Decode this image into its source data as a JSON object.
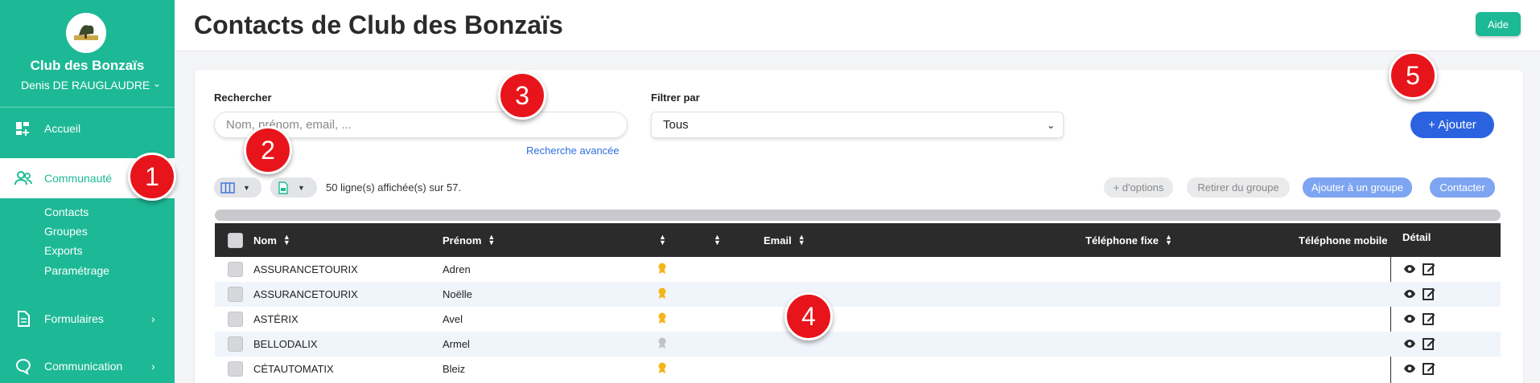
{
  "sidebar": {
    "club_name": "Club des Bonzaïs",
    "user_name": "Denis DE RAUGLAUDRE",
    "nav": [
      {
        "label": "Accueil",
        "icon": "dashboard-icon"
      },
      {
        "label": "Communauté",
        "icon": "community-icon",
        "active": true
      },
      {
        "label": "Formulaires",
        "icon": "document-icon"
      },
      {
        "label": "Communication",
        "icon": "chat-icon"
      }
    ],
    "sub_items": [
      "Contacts",
      "Groupes",
      "Exports",
      "Paramétrage"
    ]
  },
  "header": {
    "title": "Contacts de Club des Bonzaïs",
    "help_label": "Aide"
  },
  "search": {
    "label": "Rechercher",
    "placeholder": "Nom, prénom, email, ...",
    "advanced_link": "Recherche avancée"
  },
  "filter": {
    "label": "Filtrer par",
    "selected": "Tous"
  },
  "add_button": "+ Ajouter",
  "toolbar": {
    "rows_info": "50 ligne(s) affichée(s) sur 57.",
    "more_options": "+ d'options",
    "remove_group": "Retirer du groupe",
    "add_group": "Ajouter à un groupe",
    "contact": "Contacter"
  },
  "table": {
    "columns": {
      "nom": "Nom",
      "prenom": "Prénom",
      "email": "Email",
      "tel_fixe": "Téléphone fixe",
      "tel_mobile": "Téléphone mobile",
      "detail": "Détail"
    },
    "rows": [
      {
        "nom": "ASSURANCETOURIX",
        "prenom": "Adren",
        "medal": "gold"
      },
      {
        "nom": "ASSURANCETOURIX",
        "prenom": "Noëlle",
        "medal": "gold"
      },
      {
        "nom": "ASTÉRIX",
        "prenom": "Avel",
        "medal": "gold"
      },
      {
        "nom": "BELLODALIX",
        "prenom": "Armel",
        "medal": "grey"
      },
      {
        "nom": "CÉTAUTOMATIX",
        "prenom": "Bleiz",
        "medal": "gold"
      }
    ]
  },
  "callouts": [
    "1",
    "2",
    "3",
    "4",
    "5"
  ],
  "colors": {
    "brand": "#1db996",
    "primary": "#2a62e0",
    "callout": "#e8141b",
    "table_header": "#2b2b2b"
  }
}
